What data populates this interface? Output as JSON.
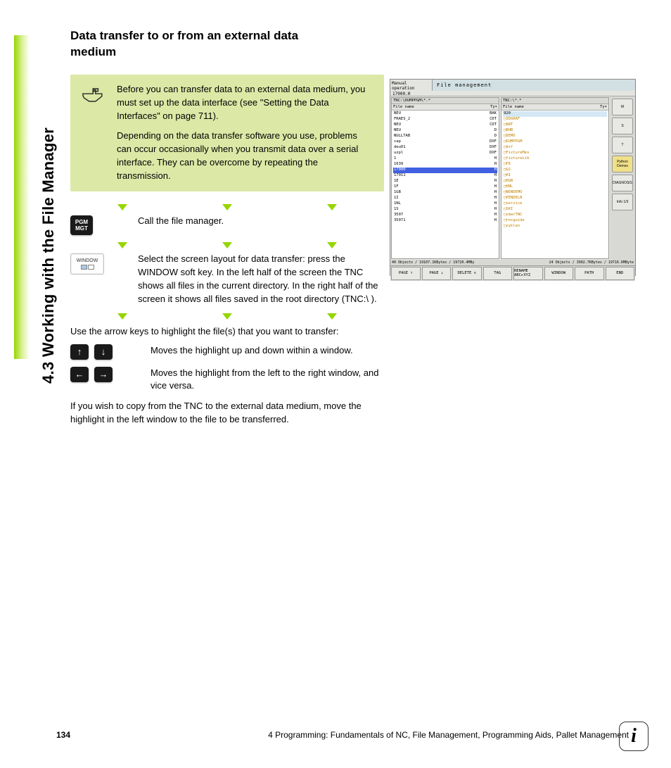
{
  "sideHeading": "4.3 Working with the File Manager",
  "heading": "Data transfer to or from an external data medium",
  "note": {
    "p1": "Before you can transfer data to an external data medium, you must set up the data interface (see \"Setting the Data Interfaces\" on page 711).",
    "p2": "Depending on the data transfer software you use, problems can occur occasionally when you transmit data over a serial interface. They can be overcome by repeating the transmission."
  },
  "key_pgm_l1": "PGM",
  "key_pgm_l2": "MGT",
  "key_window": "WINDOW",
  "step1": "Call the file manager.",
  "step2": "Select the screen layout for data transfer: press the WINDOW soft key. In the left half of the screen the TNC shows all files in the current directory. In the right half of the screen it shows all files saved in the root directory (TNC:\\ ).",
  "body1": "Use the arrow keys to highlight the file(s) that you want to transfer:",
  "step3": "Moves the highlight up and down within a window.",
  "step4": "Moves the highlight from the left to the right window, and vice versa.",
  "body2": "If you wish to copy from the TNC to the external data medium, move the highlight in the left window to the file to be transferred.",
  "footer": {
    "page": "134",
    "chapter": "4 Programming: Fundamentals of NC, File Management, Programming Aids, Pallet Management"
  },
  "screenshot": {
    "mode": "Manual operation",
    "title": "File management",
    "topfile": "17000.H",
    "leftPath": "TNC:\\DUMPPGM\\*.*",
    "rightPath": "TNC:\\*.*",
    "colHead": "File name",
    "colType": "Ty▾",
    "leftRows": [
      {
        "n": "NEU",
        "t": "BAK"
      },
      {
        "n": "FRAES_2",
        "t": "CDT"
      },
      {
        "n": "NEU",
        "t": "CDT"
      },
      {
        "n": "NEU",
        "t": "D"
      },
      {
        "n": "NULLTAB",
        "t": "D"
      },
      {
        "n": "cap",
        "t": "DXF"
      },
      {
        "n": "deu01",
        "t": "DXF"
      },
      {
        "n": "uzpl",
        "t": "DXF"
      },
      {
        "n": "1",
        "t": "H"
      },
      {
        "n": "1639",
        "t": "H"
      },
      {
        "n": "17000",
        "t": "H",
        "sel": true
      },
      {
        "n": "17011",
        "t": "H"
      },
      {
        "n": "1E",
        "t": "H"
      },
      {
        "n": "1F",
        "t": "H"
      },
      {
        "n": "1GB",
        "t": "H"
      },
      {
        "n": "1I",
        "t": "H"
      },
      {
        "n": "1NL",
        "t": "H"
      },
      {
        "n": "1S",
        "t": "H"
      },
      {
        "n": "3507",
        "t": "H"
      },
      {
        "n": "35071",
        "t": "H"
      }
    ],
    "rightRows": [
      {
        "n": "920",
        "hlt": true
      },
      {
        "n": "3DGRAF",
        "f": true
      },
      {
        "n": "AWT",
        "f": true
      },
      {
        "n": "BHB",
        "f": true
      },
      {
        "n": "DEMO",
        "f": true
      },
      {
        "n": "DUMPPGM",
        "f": true
      },
      {
        "n": "dxf",
        "f": true
      },
      {
        "n": "FixtureMes",
        "f": true
      },
      {
        "n": "fixtureLib",
        "f": true
      },
      {
        "n": "FK",
        "f": true
      },
      {
        "n": "GS",
        "f": true
      },
      {
        "n": "HI",
        "f": true
      },
      {
        "n": "HGB",
        "f": true
      },
      {
        "n": "HNL",
        "f": true
      },
      {
        "n": "NEWDEMO",
        "f": true
      },
      {
        "n": "PENDELN",
        "f": true
      },
      {
        "n": "service",
        "f": true
      },
      {
        "n": "SKI",
        "f": true
      },
      {
        "n": "smarTNC",
        "f": true
      },
      {
        "n": "tncguide",
        "f": true
      },
      {
        "n": "zyklen",
        "f": true
      }
    ],
    "statusL": "40 Objects / 19107.1KBytes / 19720.4MBy",
    "statusR": "24 Objects / 3902.7KBytes / 19716.6MByte",
    "sideBtns": [
      "M",
      "S",
      "T",
      "Python Demos",
      "DIAGNOSIS",
      "Info 1/3"
    ],
    "softkeys": [
      "PAGE ↑",
      "PAGE ↓",
      "DELETE ✕",
      "TAG",
      "RENAME ABC▸XYZ",
      "WINDOW",
      "PATH",
      "END"
    ]
  }
}
